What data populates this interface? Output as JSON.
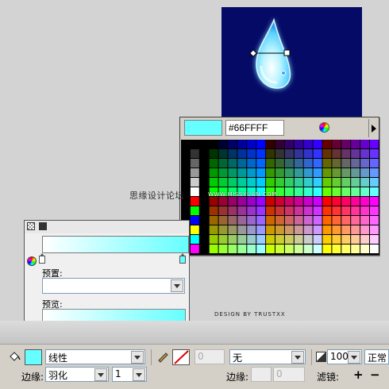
{
  "swatches": {
    "hex_value": "#66FFFF",
    "selected_color": "#66FFFF"
  },
  "watermark": {
    "chinese": "思缘设计论坛",
    "site": "WWW.MISSYUAN.COM"
  },
  "gradient_panel": {
    "preset_label": "预置:",
    "preset_value": "",
    "preview_label": "预览:",
    "start_color": "#FFFFFF",
    "end_color": "#66FFFF"
  },
  "credit": "DESIGN BY TRUSTXX",
  "toolbar": {
    "fill_type": "线性",
    "edge_label": "边缘:",
    "edge_value": "羽化",
    "edge_amount": "1",
    "stroke_width": "0",
    "stroke_style": "无",
    "edge2_label": "边缘:",
    "edge2_amount": "0",
    "opacity": "100",
    "blend_mode": "正常",
    "filters_label": "滤镜:",
    "add_filter": "+",
    "remove_filter": "−"
  },
  "colors": {
    "stage_bg": "#050A66",
    "drop_fill": "#66FFFF"
  }
}
